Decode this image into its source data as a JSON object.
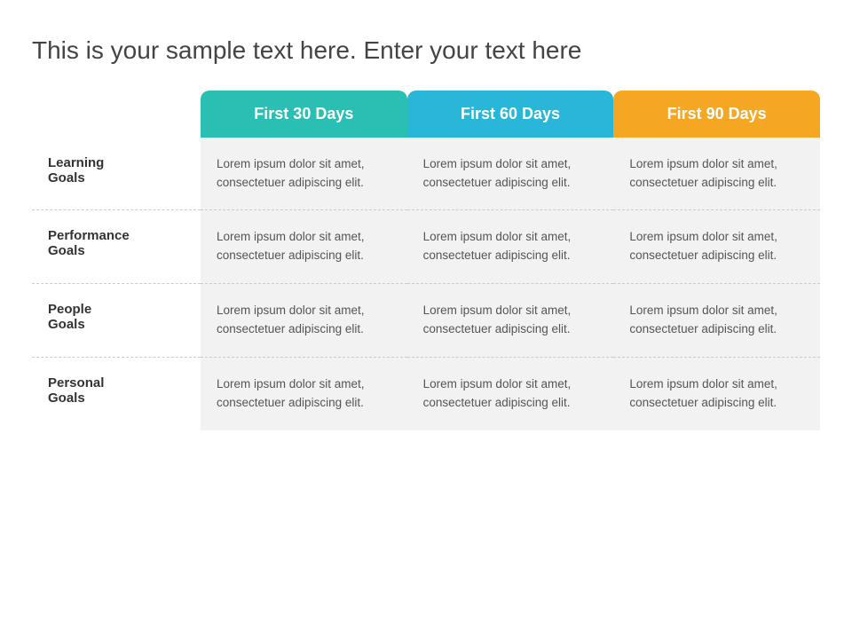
{
  "title": "This is your sample text here. Enter your text here",
  "columns": {
    "label_col": "",
    "col1_header": "First 30 Days",
    "col2_header": "First 60 Days",
    "col3_header": "First 90 Days"
  },
  "rows": [
    {
      "label": "Learning\nGoals",
      "col1": "Lorem ipsum dolor sit amet, consectetuer adipiscing elit.",
      "col2": "Lorem ipsum dolor sit amet, consectetuer adipiscing elit.",
      "col3": "Lorem ipsum dolor sit amet, consectetuer adipiscing elit."
    },
    {
      "label": "Performance\nGoals",
      "col1": "Lorem ipsum dolor sit amet, consectetuer adipiscing elit.",
      "col2": "Lorem ipsum dolor sit amet, consectetuer adipiscing elit.",
      "col3": "Lorem ipsum dolor sit amet, consectetuer adipiscing elit."
    },
    {
      "label": "People\nGoals",
      "col1": "Lorem ipsum dolor sit amet, consectetuer adipiscing elit.",
      "col2": "Lorem ipsum dolor sit amet, consectetuer adipiscing elit.",
      "col3": "Lorem ipsum dolor sit amet, consectetuer adipiscing elit."
    },
    {
      "label": "Personal\nGoals",
      "col1": "Lorem ipsum dolor sit amet, consectetuer adipiscing elit.",
      "col2": "Lorem ipsum dolor sit amet, consectetuer adipiscing elit.",
      "col3": "Lorem ipsum dolor sit amet, consectetuer adipiscing elit."
    }
  ],
  "colors": {
    "header30": "#2bbfb3",
    "header60": "#29b6d8",
    "header90": "#f5a623",
    "row_bg": "#f2f2f2",
    "label_color": "#333333",
    "text_color": "#555555",
    "title_color": "#444444",
    "divider": "#cccccc"
  }
}
